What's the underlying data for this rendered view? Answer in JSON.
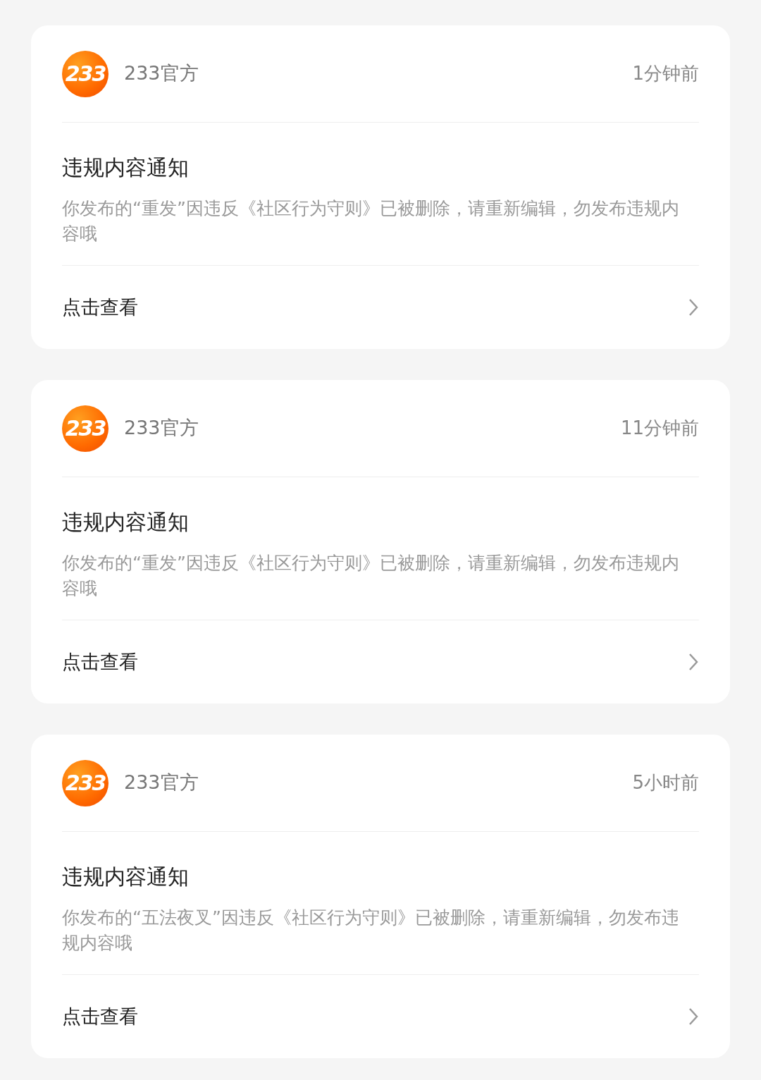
{
  "notices": [
    {
      "logo_text": "233",
      "sender": "233官方",
      "time": "1分钟前",
      "title": "违规内容通知",
      "body": "你发布的“重发”因违反《社区行为守则》已被删除，请重新编辑，勿发布违规内容哦",
      "action": "点击查看"
    },
    {
      "logo_text": "233",
      "sender": "233官方",
      "time": "11分钟前",
      "title": "违规内容通知",
      "body": "你发布的“重发”因违反《社区行为守则》已被删除，请重新编辑，勿发布违规内容哦",
      "action": "点击查看"
    },
    {
      "logo_text": "233",
      "sender": "233官方",
      "time": "5小时前",
      "title": "违规内容通知",
      "body": "你发布的“五法夜叉”因违反《社区行为守则》已被删除，请重新编辑，勿发布违规内容哦",
      "action": "点击查看"
    }
  ]
}
